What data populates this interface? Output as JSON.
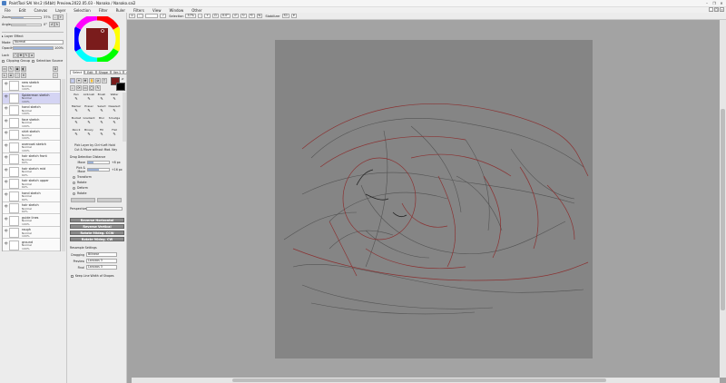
{
  "window": {
    "title": "PaintTool SAI Ver.2 (64bit) Preview.2022.05.03 - Nanako / Nanako.sai2",
    "buttons": [
      "–",
      "❐",
      "✕"
    ]
  },
  "menu": {
    "items": [
      "File",
      "Edit",
      "Canvas",
      "Layer",
      "Selection",
      "Filter",
      "Ruler",
      "Filters",
      "View",
      "Window",
      "Other"
    ]
  },
  "navigator": {
    "zoom_label": "Zoom",
    "zoom_value": "37%",
    "angle_label": "Angle",
    "angle_value": "0°"
  },
  "layer_props": {
    "header": "Layer Effect",
    "mode_label": "Mode",
    "mode_value": "Normal",
    "opacity_label": "Opacity",
    "opacity_value": "100%",
    "lock_label": "Lock",
    "clipping_label": "Clipping Group",
    "selection_source_label": "Selection Source"
  },
  "layers": [
    {
      "name": "new sketch",
      "mode": "Normal",
      "opacity": "100%"
    },
    {
      "name": "Spiderman sketch",
      "mode": "Normal",
      "opacity": "100%",
      "selected": true
    },
    {
      "name": "hand sketch",
      "mode": "Normal",
      "opacity": "100%"
    },
    {
      "name": "face sketch",
      "mode": "Normal",
      "opacity": "100%"
    },
    {
      "name": "shirt sketch",
      "mode": "Normal",
      "opacity": "100%"
    },
    {
      "name": "overcoat sketch",
      "mode": "Normal",
      "opacity": "100%"
    },
    {
      "name": "hair sketch front",
      "mode": "Normal",
      "opacity": "60%"
    },
    {
      "name": "hair sketch mid",
      "mode": "Normal",
      "opacity": "60%"
    },
    {
      "name": "hair sketch upper",
      "mode": "Normal",
      "opacity": "60%"
    },
    {
      "name": "hand sketch",
      "mode": "Normal",
      "opacity": "60%"
    },
    {
      "name": "hair sketch",
      "mode": "Normal",
      "opacity": "60%"
    },
    {
      "name": "guide lines",
      "mode": "Normal",
      "opacity": "100%"
    },
    {
      "name": "rough",
      "mode": "Normal",
      "opacity": "100%"
    },
    {
      "name": "ground",
      "mode": "Normal",
      "opacity": "100%"
    }
  ],
  "tool_tabs": [
    "Select",
    "Edit",
    "Shape",
    "Ver.1",
    "Other"
  ],
  "tools": [
    {
      "name": "Pen",
      "label": "Pen"
    },
    {
      "name": "AirBrush",
      "label": "Airbrush"
    },
    {
      "name": "Brush",
      "label": "Brush"
    },
    {
      "name": "Water",
      "label": "Water"
    },
    {
      "name": "Marker",
      "label": "Marker"
    },
    {
      "name": "Eraser",
      "label": "Eraser"
    },
    {
      "name": "SelPen",
      "label": "Select"
    },
    {
      "name": "SelEras",
      "label": "Deselect"
    },
    {
      "name": "Bucket",
      "label": "Bucket"
    },
    {
      "name": "Gradient",
      "label": "Gradient"
    },
    {
      "name": "Blur",
      "label": "Blur"
    },
    {
      "name": "Smudge",
      "label": "Smudge"
    },
    {
      "name": "Pencil",
      "label": "Pencil"
    },
    {
      "name": "Binary",
      "label": "Binary"
    },
    {
      "name": "Fill",
      "label": "Fill"
    },
    {
      "name": "Flat",
      "label": "Flat"
    }
  ],
  "tool_options": {
    "pick_layer": "Pick Layer by Ctrl+Left Hold",
    "cut_move": "Cut & Move without Mod. Key",
    "snap_header": "Drag Detection Distance",
    "move_label": "Move",
    "move_value": "+8 px",
    "pick_label": "Pick & Move",
    "pick_value": "+16 px",
    "transform_labels": [
      "Transform",
      "Rotate",
      "Deform",
      "Rotate"
    ],
    "perspective_label": "Perspective",
    "flip_buttons": [
      "Reverse Horizontal",
      "Reverse Vertical",
      "Rotate 90deg. CCW",
      "Rotate 90deg. CW"
    ],
    "resample_header": "Resample Settings",
    "dragging_label": "Dragging",
    "dragging_value": "Bilinear",
    "preview_label": "Preview",
    "preview_value": "Lanczos 3",
    "final_label": "Final",
    "final_value": "Lanczos 3",
    "keep_line": "Keep Line Width of Shapes"
  },
  "canvas_toolbar": {
    "selection_label": "Selection",
    "zoom_value": "37%",
    "angle_value": "0.0°",
    "stabilizer_label": "Stabilizer",
    "stabilizer_value": "S1"
  },
  "colors": {
    "primary": "#7a1c1c",
    "secondary": "#000000",
    "accent": "#9cb1d6",
    "bg": "#a3a3a3",
    "paper": "#858585",
    "sketch_red": "#8b2a2a",
    "sketch_gray": "#555555"
  },
  "icons": [
    "search-icon",
    "eye-icon",
    "lock-icon",
    "folder-icon",
    "trash-icon",
    "minimize-icon",
    "maximize-icon",
    "close-icon"
  ]
}
